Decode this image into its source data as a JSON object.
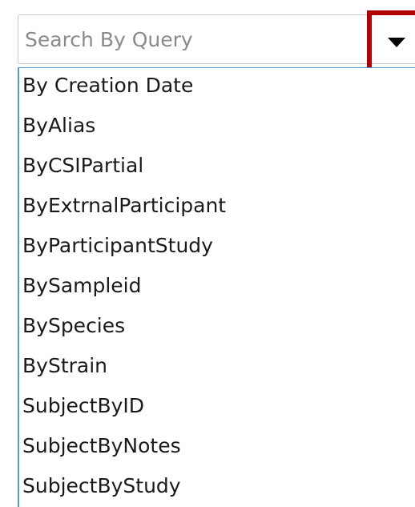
{
  "search": {
    "placeholder": "Search By Query",
    "value": ""
  },
  "dropdown": {
    "toggle_icon": "caret-down-icon",
    "highlight_color": "#b00000",
    "list_border_color": "#5b9bd5",
    "options": [
      {
        "label": "By Creation Date"
      },
      {
        "label": "ByAlias"
      },
      {
        "label": "ByCSIPartial"
      },
      {
        "label": "ByExtrnalParticipant"
      },
      {
        "label": "ByParticipantStudy"
      },
      {
        "label": "BySampleid"
      },
      {
        "label": "BySpecies"
      },
      {
        "label": "ByStrain"
      },
      {
        "label": "SubjectByID"
      },
      {
        "label": "SubjectByNotes"
      },
      {
        "label": "SubjectByStudy"
      }
    ]
  }
}
